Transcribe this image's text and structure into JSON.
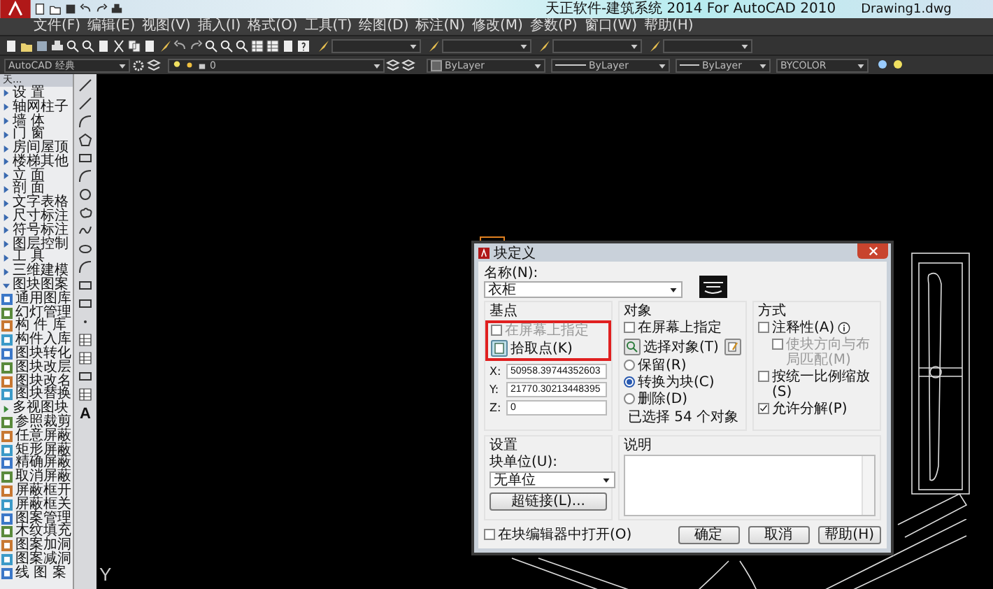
{
  "title_bar": {
    "title": "天正软件-建筑系统 2014  For AutoCAD 2010",
    "document": "Drawing1.dwg"
  },
  "menu_bar": [
    {
      "label": "文件(F)"
    },
    {
      "label": "编辑(E)"
    },
    {
      "label": "视图(V)"
    },
    {
      "label": "插入(I)"
    },
    {
      "label": "格式(O)"
    },
    {
      "label": "工具(T)"
    },
    {
      "label": "绘图(D)"
    },
    {
      "label": "标注(N)"
    },
    {
      "label": "修改(M)"
    },
    {
      "label": "参数(P)"
    },
    {
      "label": "窗口(W)"
    },
    {
      "label": "帮助(H)"
    }
  ],
  "properties_bar": {
    "workspace": "AutoCAD 经典",
    "layer": "0",
    "color_setting": "ByLayer",
    "linetype": "ByLayer",
    "lineweight": "ByLayer",
    "plot_style": "BYCOLOR"
  },
  "side_panel": {
    "title": "天...",
    "items": [
      {
        "label": "设 置",
        "kind": "folder",
        "expanded": false
      },
      {
        "label": "轴网柱子",
        "kind": "folder",
        "expanded": false
      },
      {
        "label": "墙 体",
        "kind": "folder",
        "expanded": false
      },
      {
        "label": "门 窗",
        "kind": "folder",
        "expanded": false
      },
      {
        "label": "房间屋顶",
        "kind": "folder",
        "expanded": false
      },
      {
        "label": "楼梯其他",
        "kind": "folder",
        "expanded": false
      },
      {
        "label": "立 面",
        "kind": "folder",
        "expanded": false
      },
      {
        "label": "剖 面",
        "kind": "folder",
        "expanded": false
      },
      {
        "label": "文字表格",
        "kind": "folder",
        "expanded": false
      },
      {
        "label": "尺寸标注",
        "kind": "folder",
        "expanded": false
      },
      {
        "label": "符号标注",
        "kind": "folder",
        "expanded": false
      },
      {
        "label": "图层控制",
        "kind": "folder",
        "expanded": false
      },
      {
        "label": "工 具",
        "kind": "folder",
        "expanded": false
      },
      {
        "label": "三维建模",
        "kind": "folder",
        "expanded": false
      },
      {
        "label": "图块图案",
        "kind": "folder",
        "expanded": true,
        "children": [
          {
            "label": "通用图库",
            "kind": "command"
          },
          {
            "label": "幻灯管理",
            "kind": "command"
          },
          {
            "label": "构 件 库",
            "kind": "command"
          },
          {
            "label": "构件入库",
            "kind": "command"
          },
          {
            "label": "图块转化",
            "kind": "command"
          },
          {
            "label": "图块改层",
            "kind": "command"
          },
          {
            "label": "图块改名",
            "kind": "command"
          },
          {
            "label": "图块替换",
            "kind": "command"
          },
          {
            "label": "多视图块",
            "kind": "folder",
            "expanded": false
          },
          {
            "label": "参照裁剪",
            "kind": "command"
          },
          {
            "label": "任意屏蔽",
            "kind": "command"
          },
          {
            "label": "矩形屏蔽",
            "kind": "command"
          },
          {
            "label": "精确屏蔽",
            "kind": "command"
          },
          {
            "label": "取消屏蔽",
            "kind": "command"
          },
          {
            "label": "屏蔽框开",
            "kind": "command"
          },
          {
            "label": "屏蔽框关",
            "kind": "command"
          },
          {
            "label": "图案管理",
            "kind": "command"
          },
          {
            "label": "木纹填充",
            "kind": "command"
          },
          {
            "label": "图案加洞",
            "kind": "command"
          },
          {
            "label": "图案减洞",
            "kind": "command"
          },
          {
            "label": "线 图 案",
            "kind": "command"
          }
        ]
      }
    ]
  },
  "draw_toolbar": {
    "text_tool": "A"
  },
  "canvas": {
    "axis_label": "Y"
  },
  "dialog": {
    "title": "块定义",
    "name_label": "名称(N):",
    "name_value": "衣柜",
    "base_point": {
      "title": "基点",
      "highlighted": true,
      "on_screen": {
        "label": "在屏幕上指定",
        "checked": false,
        "disabled": true
      },
      "pick_button": "拾取点(K)",
      "coords": [
        {
          "axis": "X:",
          "value": "50958.39744352603"
        },
        {
          "axis": "Y:",
          "value": "21770.30213448395"
        },
        {
          "axis": "Z:",
          "value": "0"
        }
      ]
    },
    "objects": {
      "title": "对象",
      "on_screen": {
        "label": "在屏幕上指定",
        "checked": false,
        "disabled": false
      },
      "select_button": "选择对象(T)",
      "options": [
        {
          "label": "保留(R)",
          "selected": false
        },
        {
          "label": "转换为块(C)",
          "selected": true
        },
        {
          "label": "删除(D)",
          "selected": false
        }
      ],
      "status": "已选择 54 个对象"
    },
    "behavior": {
      "title": "方式",
      "options": [
        {
          "label": "注释性(A)",
          "checked": false,
          "disabled": false,
          "info": true,
          "children": [
            {
              "label": "使块方向与布局匹配(M)",
              "checked": false,
              "disabled": true,
              "info": false
            }
          ]
        },
        {
          "label": "按统一比例缩放(S)",
          "checked": false,
          "disabled": false,
          "info": false
        },
        {
          "label": "允许分解(P)",
          "checked": true,
          "disabled": false,
          "info": false
        }
      ]
    },
    "settings": {
      "title": "设置",
      "unit_label": "块单位(U):",
      "unit_value": "无单位",
      "hyperlink_button": "超链接(L)..."
    },
    "description": {
      "title": "说明"
    },
    "open_in_editor": {
      "label": "在块编辑器中打开(O)",
      "checked": false
    },
    "buttons": [
      {
        "label": "确定"
      },
      {
        "label": "取消"
      },
      {
        "label": "帮助(H)"
      }
    ]
  }
}
